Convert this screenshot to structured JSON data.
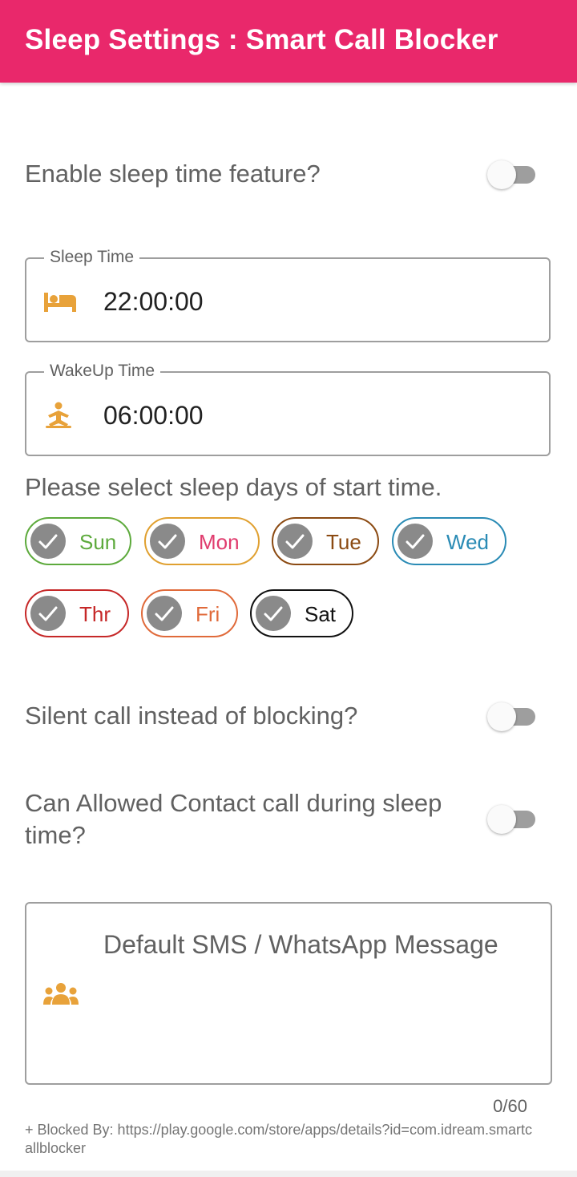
{
  "appbar": {
    "title": "Sleep Settings : Smart Call Blocker",
    "color": "#E9286B"
  },
  "enable_sleep": {
    "label": "Enable sleep time feature?",
    "checked": false
  },
  "sleep_time": {
    "label": "Sleep Time",
    "value": "22:00:00",
    "icon": "bed-icon"
  },
  "wakeup_time": {
    "label": "WakeUp Time",
    "value": "06:00:00",
    "icon": "meditation-icon"
  },
  "days": {
    "prompt": "Please select sleep days of start time.",
    "items": [
      {
        "label": "Sun",
        "color": "#5DAA3C",
        "selected": true
      },
      {
        "label": "Mon",
        "color": "#E0A030",
        "text_color": "#E03C6E",
        "selected": true
      },
      {
        "label": "Tue",
        "color": "#8B4A12",
        "selected": true
      },
      {
        "label": "Wed",
        "color": "#2A8BB5",
        "selected": true
      },
      {
        "label": "Thr",
        "color": "#C62828",
        "selected": true
      },
      {
        "label": "Fri",
        "color": "#E06A3A",
        "selected": true
      },
      {
        "label": "Sat",
        "color": "#111111",
        "selected": true
      }
    ]
  },
  "silent_call": {
    "label": "Silent call instead of blocking?",
    "checked": false
  },
  "allowed_contact": {
    "label": "Can Allowed Contact call during sleep time?",
    "checked": false
  },
  "message": {
    "placeholder": "Default SMS / WhatsApp Message",
    "counter": "0/60",
    "icon": "group-icon"
  },
  "footer": {
    "text": "+ Blocked By: https://play.google.com/store/apps/details?id=com.idream.smartcallblocker"
  },
  "accent_icon_color": "#E8A23A"
}
